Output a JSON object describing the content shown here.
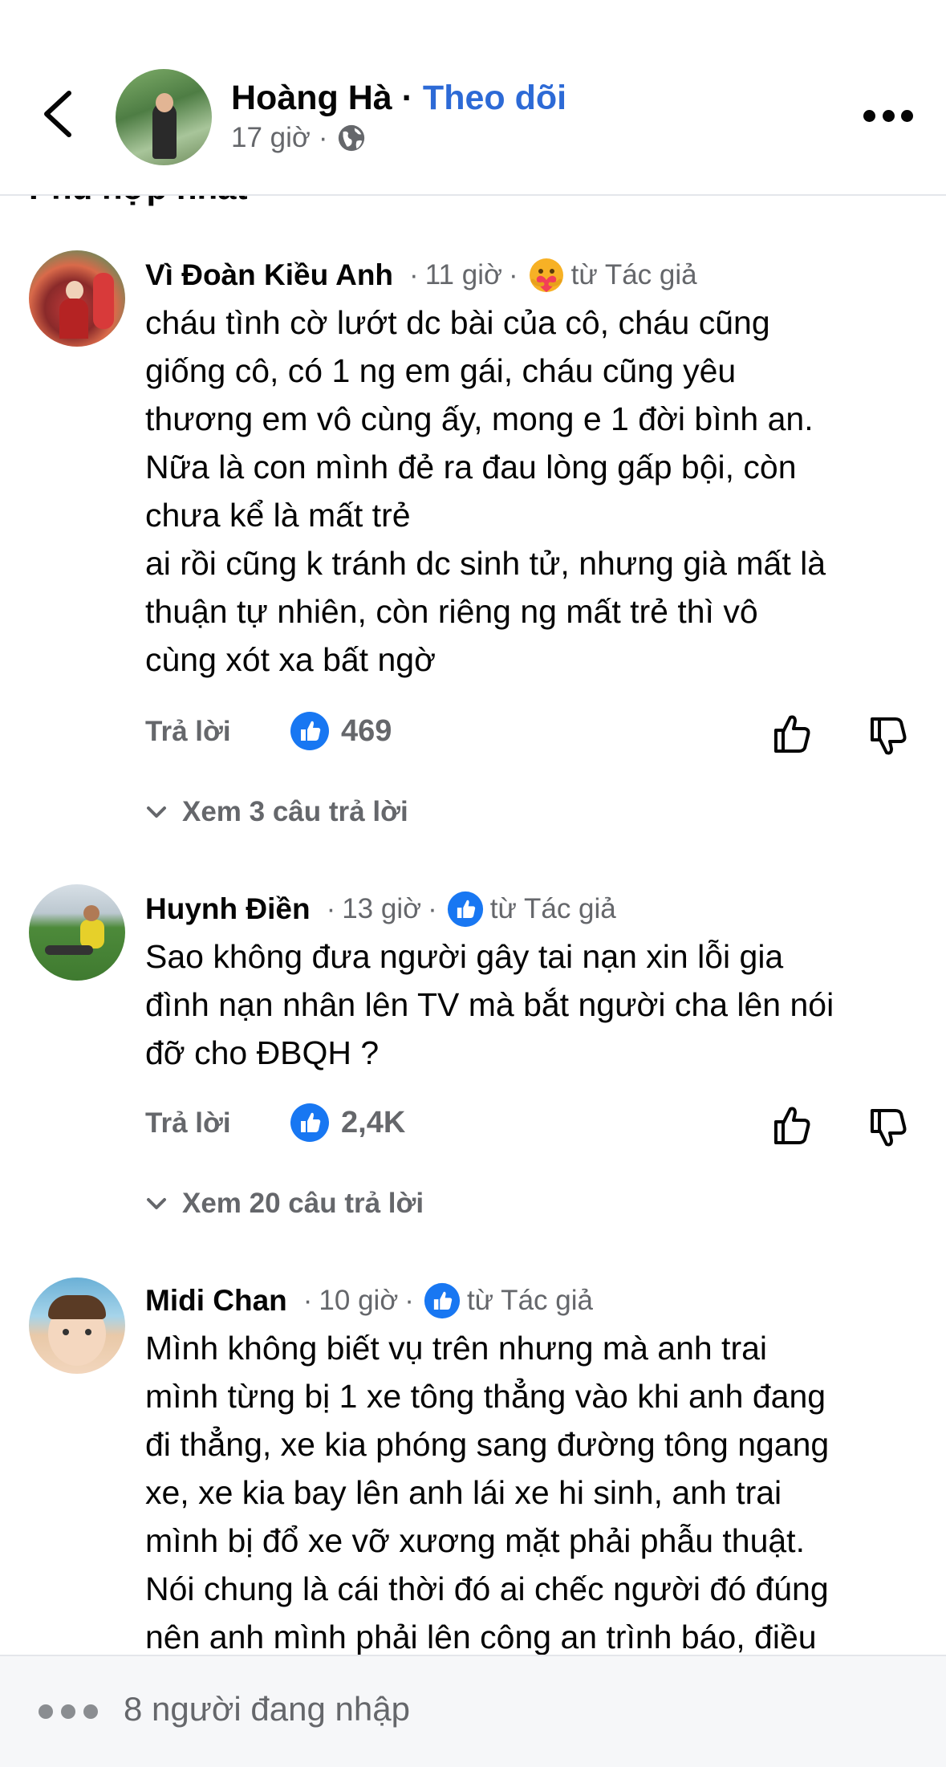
{
  "header": {
    "author": "Hoàng Hà",
    "separator": "·",
    "follow_label": "Theo dõi",
    "time": "17 giờ",
    "meta_sep": "·",
    "privacy_icon": "globe-icon"
  },
  "sort_label": "Phù hợp nhất",
  "comments": [
    {
      "author": "Vì Đoàn Kiều Anh",
      "sep1": "·",
      "time": "11 giờ",
      "sep2": "·",
      "reaction_icon": "care-reaction-icon",
      "from_author": "từ Tác giả",
      "text": "cháu tình cờ lướt dc bài của cô, cháu cũng\ngiống cô, có 1 ng em gái, cháu cũng yêu\nthương em vô cùng ấy, mong e 1 đời bình an.\nNữa là con mình đẻ ra đau lòng gấp bội, còn\nchưa kể là mất trẻ\nai rồi cũng k tránh dc sinh tử, nhưng già mất là\nthuận tự nhiên, còn riêng ng mất trẻ thì vô\ncùng xót xa bất ngờ",
      "reply_label": "Trả lời",
      "like_count": "469",
      "see_replies": "Xem 3 câu trả lời"
    },
    {
      "author": "Huynh Điền",
      "sep1": "·",
      "time": "13 giờ",
      "sep2": "·",
      "reaction_icon": "like-reaction-icon",
      "from_author": "từ Tác giả",
      "text": "Sao không đưa người gây tai nạn xin lỗi gia\nđình nạn nhân lên TV mà bắt người cha lên nói\nđỡ cho ĐBQH ?",
      "reply_label": "Trả lời",
      "like_count": "2,4K",
      "see_replies": "Xem 20 câu trả lời"
    },
    {
      "author": "Midi Chan",
      "sep1": "·",
      "time": "10 giờ",
      "sep2": "·",
      "reaction_icon": "like-reaction-icon",
      "from_author": "từ Tác giả",
      "text": "Mình không biết vụ trên nhưng mà anh trai\nmình từng bị 1 xe tông thẳng vào khi anh đang\nđi thẳng, xe kia phóng sang đường tông ngang\nxe, xe kia bay lên anh lái xe hi sinh, anh trai\nmình bị đổ xe vỡ xương mặt phải phẫu thuật.\nNói chung là cái thời đó ai chếc người đó đúng\nnên anh mình phải lên công an trình báo, điều"
    }
  ],
  "footer": {
    "typing_text": "8 người đang nhập"
  },
  "colors": {
    "accent": "#2d6ad6",
    "secondary_text": "#65676b",
    "like_blue": "#1877f2"
  }
}
